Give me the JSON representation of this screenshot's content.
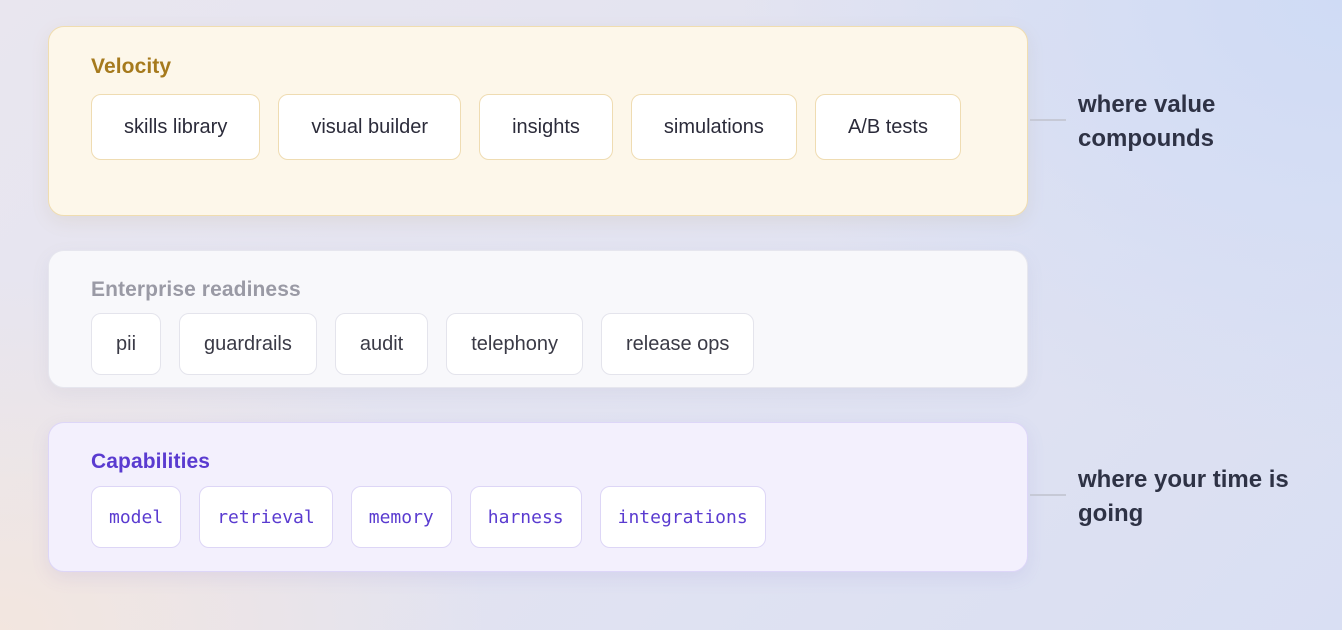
{
  "panels": {
    "velocity": {
      "title": "Velocity",
      "items": [
        "skills library",
        "visual builder",
        "insights",
        "simulations",
        "A/B tests"
      ]
    },
    "enterprise": {
      "title": "Enterprise readiness",
      "items": [
        "pii",
        "guardrails",
        "audit",
        "telephony",
        "release ops"
      ]
    },
    "capabilities": {
      "title": "Capabilities",
      "items": [
        "model",
        "retrieval",
        "memory",
        "harness",
        "integrations"
      ]
    }
  },
  "annotations": {
    "top": "where value compounds",
    "bottom": "where your time is going"
  },
  "colors": {
    "velocity_accent": "#a67a1d",
    "enterprise_accent": "#9a9aa5",
    "capabilities_accent": "#5a3bd0"
  }
}
